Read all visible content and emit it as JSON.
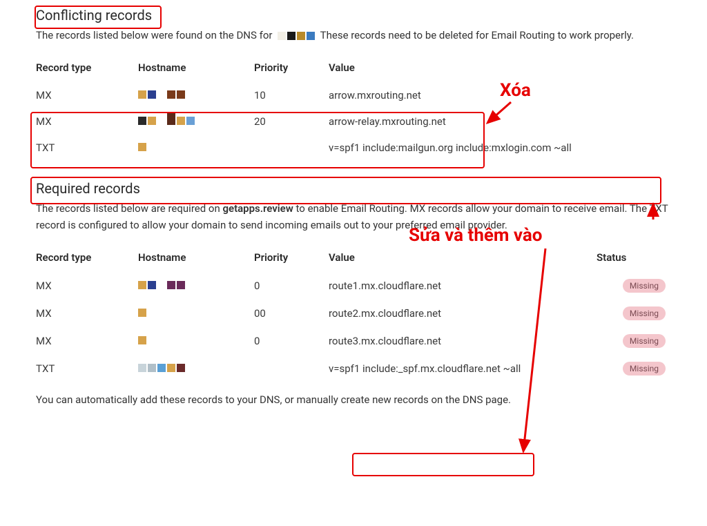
{
  "conflicting": {
    "title": "Conflicting records",
    "desc_pre": "The records listed below were found on the DNS for",
    "desc_post": "These records need to be deleted for Email Routing to work properly.",
    "headers": {
      "type": "Record type",
      "host": "Hostname",
      "prio": "Priority",
      "value": "Value"
    },
    "rows": [
      {
        "type": "MX",
        "prio": "10",
        "value": "arrow.mxrouting.net"
      },
      {
        "type": "MX",
        "prio": "20",
        "value": "arrow-relay.mxrouting.net"
      },
      {
        "type": "TXT",
        "prio": "",
        "value": "v=spf1 include:mailgun.org include:mxlogin.com ~all"
      }
    ]
  },
  "required": {
    "title": "Required records",
    "desc_pre": "The records listed below are required on ",
    "desc_bold": "getapps.review",
    "desc_post": " to enable Email Routing. MX records allow your domain to receive email. The TXT record is configured to allow your domain to send incoming emails out to your preferred email provider.",
    "headers": {
      "type": "Record type",
      "host": "Hostname",
      "prio": "Priority",
      "value": "Value",
      "status": "Status"
    },
    "rows": [
      {
        "type": "MX",
        "prio": "0",
        "value": "route1.mx.cloudflare.net",
        "status": "Missing"
      },
      {
        "type": "MX",
        "prio": "00",
        "value": "route2.mx.cloudflare.net",
        "status": "Missing"
      },
      {
        "type": "MX",
        "prio": "0",
        "value": "route3.mx.cloudflare.net",
        "status": "Missing"
      },
      {
        "type": "TXT",
        "prio": "",
        "value_pre": "v=spf1 ",
        "value_box": "include:_spf.mx.cloudflare.net",
        "value_post": " ~all",
        "status": "Missing"
      }
    ],
    "footnote": "You can automatically add these records to your DNS, or manually create new records on the DNS page."
  },
  "annotations": {
    "xoa": "Xóa",
    "sua": "Sửa và thêm vào"
  },
  "colors": {
    "anno": "#e60000",
    "badge_bg": "#f4c6cc"
  }
}
